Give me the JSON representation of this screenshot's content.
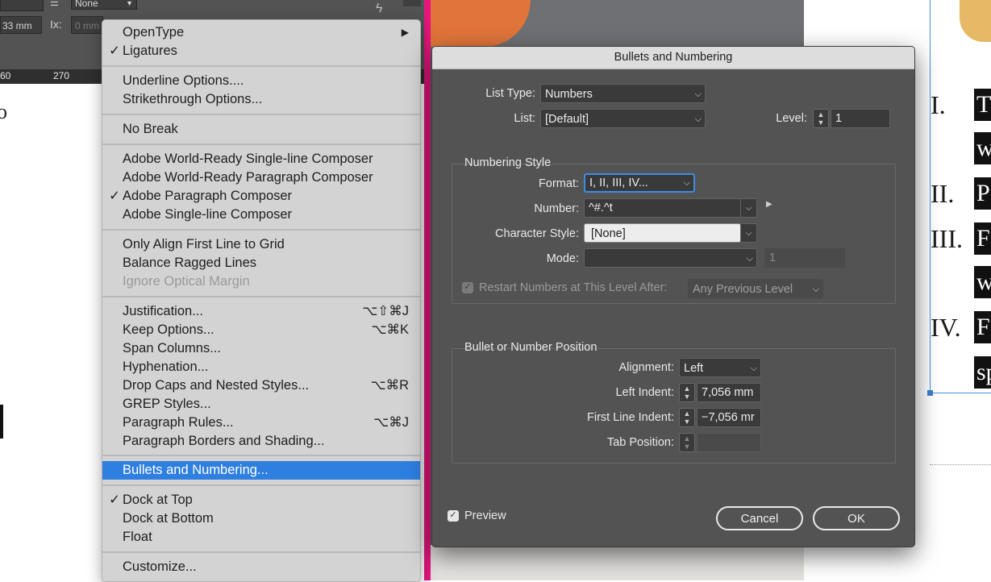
{
  "toolbar": {
    "field_top": "None",
    "field_width": "33 mm",
    "field_offset": "0 mm",
    "offset_icon_text": "Ix:",
    "ruler_labels": [
      "60",
      "270"
    ],
    "left_text_fragment": "o"
  },
  "menu": {
    "items": [
      {
        "label": "OpenType",
        "checked": false,
        "shortcut": "▶",
        "disabled": false
      },
      {
        "label": "Ligatures",
        "checked": true,
        "shortcut": "",
        "disabled": false
      },
      {
        "label": "Underline Options....",
        "checked": false,
        "shortcut": "",
        "disabled": false
      },
      {
        "label": "Strikethrough Options...",
        "checked": false,
        "shortcut": "",
        "disabled": false
      },
      {
        "label": "No Break",
        "checked": false,
        "shortcut": "",
        "disabled": false
      },
      {
        "label": "Adobe World-Ready Single-line Composer",
        "checked": false,
        "shortcut": "",
        "disabled": false
      },
      {
        "label": "Adobe World-Ready Paragraph Composer",
        "checked": false,
        "shortcut": "",
        "disabled": false
      },
      {
        "label": "Adobe Paragraph Composer",
        "checked": true,
        "shortcut": "",
        "disabled": false
      },
      {
        "label": "Adobe Single-line Composer",
        "checked": false,
        "shortcut": "",
        "disabled": false
      },
      {
        "label": "Only Align First Line to Grid",
        "checked": false,
        "shortcut": "",
        "disabled": false
      },
      {
        "label": "Balance Ragged Lines",
        "checked": false,
        "shortcut": "",
        "disabled": false
      },
      {
        "label": "Ignore Optical Margin",
        "checked": false,
        "shortcut": "",
        "disabled": true
      },
      {
        "label": "Justification...",
        "checked": false,
        "shortcut": "⌥⇧⌘J",
        "disabled": false
      },
      {
        "label": "Keep Options...",
        "checked": false,
        "shortcut": "⌥⌘K",
        "disabled": false
      },
      {
        "label": "Span Columns...",
        "checked": false,
        "shortcut": "",
        "disabled": false
      },
      {
        "label": "Hyphenation...",
        "checked": false,
        "shortcut": "",
        "disabled": false
      },
      {
        "label": "Drop Caps and Nested Styles...",
        "checked": false,
        "shortcut": "⌥⌘R",
        "disabled": false
      },
      {
        "label": "GREP Styles...",
        "checked": false,
        "shortcut": "",
        "disabled": false
      },
      {
        "label": "Paragraph Rules...",
        "checked": false,
        "shortcut": "⌥⌘J",
        "disabled": false
      },
      {
        "label": "Paragraph Borders and Shading...",
        "checked": false,
        "shortcut": "",
        "disabled": false
      },
      {
        "label": "Bullets and Numbering...",
        "checked": false,
        "shortcut": "",
        "disabled": false,
        "highlighted": true
      },
      {
        "label": "Dock at Top",
        "checked": true,
        "shortcut": "",
        "disabled": false
      },
      {
        "label": "Dock at Bottom",
        "checked": false,
        "shortcut": "",
        "disabled": false
      },
      {
        "label": "Float",
        "checked": false,
        "shortcut": "",
        "disabled": false
      },
      {
        "label": "Customize...",
        "checked": false,
        "shortcut": "",
        "disabled": false
      }
    ],
    "check_glyph": "✓"
  },
  "dialog": {
    "title": "Bullets and Numbering",
    "list_type_label": "List Type:",
    "list_type_value": "Numbers",
    "list_label": "List:",
    "list_value": "[Default]",
    "level_label": "Level:",
    "level_value": "1",
    "numbering_style": {
      "title": "Numbering Style",
      "format_label": "Format:",
      "format_value": "I, II, III, IV...",
      "number_label": "Number:",
      "number_value": "^#.^t",
      "char_style_label": "Character Style:",
      "char_style_value": "[None]",
      "mode_label": "Mode:",
      "mode_value": "",
      "mode_number": "1",
      "restart_label": "Restart Numbers at This Level After:",
      "restart_checked": true,
      "restart_value": "Any Previous Level"
    },
    "position": {
      "title": "Bullet or Number Position",
      "alignment_label": "Alignment:",
      "alignment_value": "Left",
      "left_indent_label": "Left Indent:",
      "left_indent_value": "7,056 mm",
      "first_line_label": "First Line Indent:",
      "first_line_value": "−7,056 mr",
      "tab_label": "Tab Position:",
      "tab_value": ""
    },
    "preview_label": "Preview",
    "preview_checked": true,
    "cancel_label": "Cancel",
    "ok_label": "OK"
  },
  "right_page": {
    "numerals": [
      "I.",
      "II.",
      "III.",
      "IV."
    ],
    "text_fragments": [
      "T",
      "w",
      "P",
      "F",
      "w",
      "F",
      "sp"
    ]
  },
  "colors": {
    "highlight": "#2e7fe0",
    "pink_edge": "#e8157f",
    "dialog_bg": "#535353",
    "focus_ring": "#3a8ee6"
  }
}
